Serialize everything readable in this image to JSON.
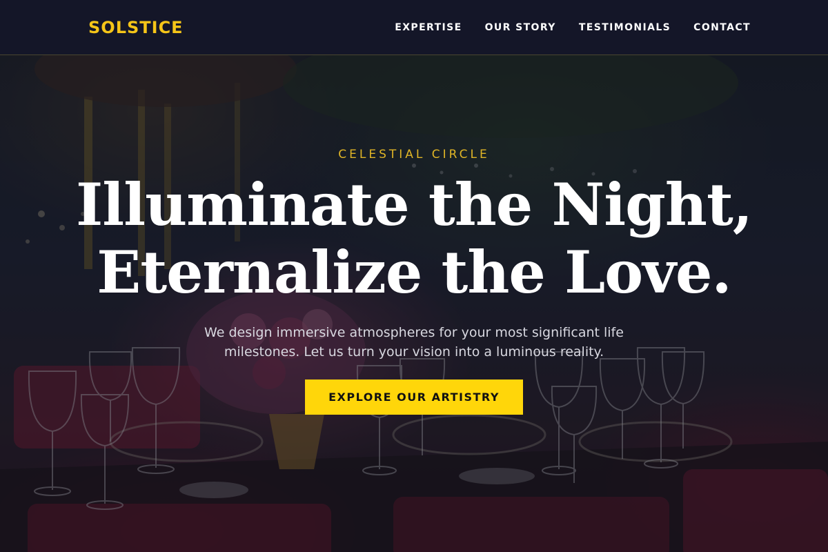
{
  "nav": {
    "brand": "SOLSTICE",
    "links": [
      "EXPERTISE",
      "OUR STORY",
      "TESTIMONIALS",
      "CONTACT"
    ]
  },
  "hero": {
    "eyebrow": "CELESTIAL CIRCLE",
    "headline_lines": [
      "Illuminate the Night,",
      "Eternalize the Love."
    ],
    "subtext": "We design immersive atmospheres for your most significant life milestones. Let us turn your vision into a luminous reality.",
    "cta_label": "EXPLORE OUR ARTISTRY"
  },
  "colors": {
    "accent": "#ffd60a",
    "brand": "#f5c518",
    "nav_background": "#141628",
    "headline": "#ffffff"
  }
}
